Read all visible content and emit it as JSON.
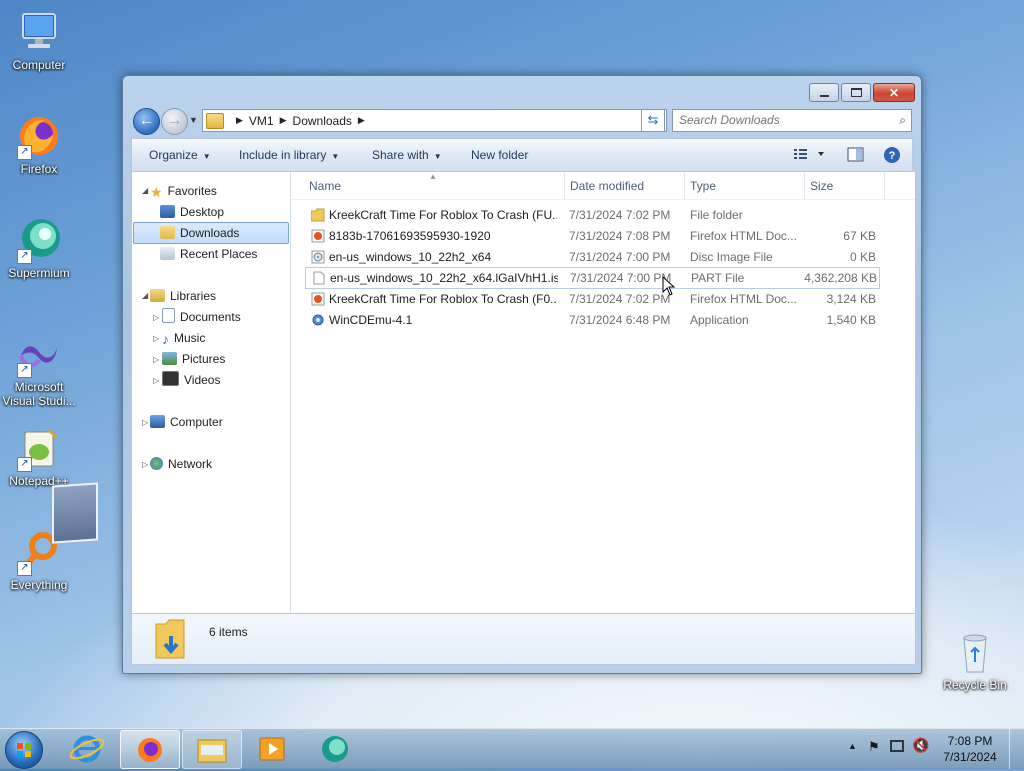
{
  "desktop": {
    "icons": [
      {
        "label": "Computer"
      },
      {
        "label": "Firefox"
      },
      {
        "label": "Supermium"
      },
      {
        "label": "Microsoft Visual Studi..."
      },
      {
        "label": "Notepad++"
      },
      {
        "label": "Everything"
      },
      {
        "label": "Recycle Bin"
      }
    ]
  },
  "window": {
    "address": {
      "crumbs": [
        "VM1",
        "Downloads"
      ]
    },
    "search": {
      "placeholder": "Search Downloads"
    },
    "toolbar": {
      "organize": "Organize",
      "include_in_library": "Include in library",
      "share_with": "Share with",
      "new_folder": "New folder"
    },
    "nav": {
      "favorites": "Favorites",
      "desktop": "Desktop",
      "downloads": "Downloads",
      "recent_places": "Recent Places",
      "libraries": "Libraries",
      "documents": "Documents",
      "music": "Music",
      "pictures": "Pictures",
      "videos": "Videos",
      "computer": "Computer",
      "network": "Network"
    },
    "columns": {
      "name": "Name",
      "date": "Date modified",
      "type": "Type",
      "size": "Size"
    },
    "files": [
      {
        "name": "KreekCraft Time For Roblox To Crash (FU...",
        "date": "7/31/2024 7:02 PM",
        "type": "File folder",
        "size": "",
        "icon": "folder-icon"
      },
      {
        "name": "8183b-17061693595930-1920",
        "date": "7/31/2024 7:08 PM",
        "type": "Firefox HTML Doc...",
        "size": "67 KB",
        "icon": "html-doc-icon"
      },
      {
        "name": "en-us_windows_10_22h2_x64",
        "date": "7/31/2024 7:00 PM",
        "type": "Disc Image File",
        "size": "0 KB",
        "icon": "disc-image-icon"
      },
      {
        "name": "en-us_windows_10_22h2_x64.lGaIVhH1.is...",
        "date": "7/31/2024 7:00 PM",
        "type": "PART File",
        "size": "4,362,208 KB",
        "icon": "generic-file-icon"
      },
      {
        "name": "KreekCraft Time For Roblox To Crash (F0...",
        "date": "7/31/2024 7:02 PM",
        "type": "Firefox HTML Doc...",
        "size": "3,124 KB",
        "icon": "html-doc-icon"
      },
      {
        "name": "WinCDEmu-4.1",
        "date": "7/31/2024 6:48 PM",
        "type": "Application",
        "size": "1,540 KB",
        "icon": "app-icon"
      }
    ],
    "status": {
      "count": "6 items"
    }
  },
  "taskbar": {
    "clock": {
      "time": "7:08 PM",
      "date": "7/31/2024"
    }
  },
  "colors": {
    "accent": "#2b6cc4",
    "selection": "#c1dcfc",
    "taskbar": "#7396b4"
  }
}
